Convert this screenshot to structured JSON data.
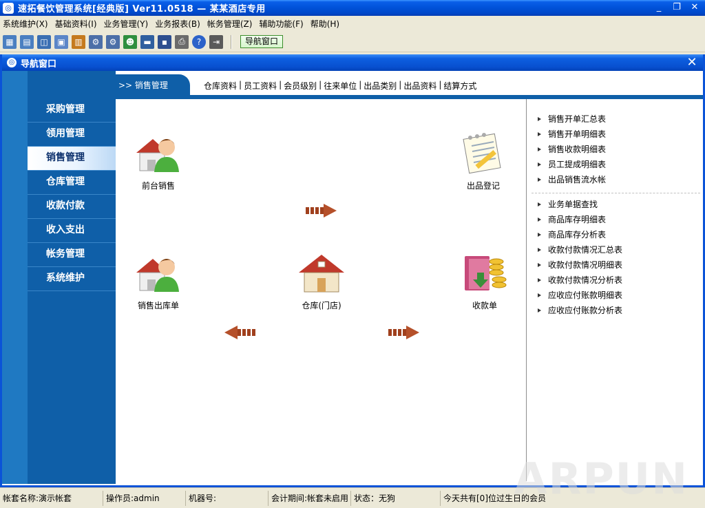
{
  "window": {
    "title": "速拓餐饮管理系统[经典版] Ver11.0518 — 某某酒店专用",
    "minimize": "_",
    "restore": "❐",
    "close": "✕"
  },
  "menu": [
    "系统维护(X)",
    "基础资料(I)",
    "业务管理(Y)",
    "业务报表(B)",
    "帐务管理(Z)",
    "辅助功能(F)",
    "帮助(H)"
  ],
  "toolbar": {
    "icons": [
      {
        "name": "grid-icon",
        "glyph": "▦",
        "color": "#4a7fc1"
      },
      {
        "name": "list-icon",
        "glyph": "▤",
        "color": "#4a7fc1"
      },
      {
        "name": "windows-icon",
        "glyph": "◫",
        "color": "#3a6fb3"
      },
      {
        "name": "form-icon",
        "glyph": "▣",
        "color": "#5b86c8"
      },
      {
        "name": "chart-icon",
        "glyph": "▥",
        "color": "#c57a1e"
      },
      {
        "name": "gear-icon",
        "glyph": "⚙",
        "color": "#4c6fa8"
      },
      {
        "name": "settings-icon",
        "glyph": "⚙",
        "color": "#4c6fa8"
      },
      {
        "name": "users-icon",
        "glyph": "☻",
        "color": "#2f8f3f"
      },
      {
        "name": "panel-icon",
        "glyph": "▬",
        "color": "#2f5f9f"
      },
      {
        "name": "save-icon",
        "glyph": "▪",
        "color": "#2e4f8f"
      },
      {
        "name": "print-icon",
        "glyph": "⎙",
        "color": "#6b6b6b"
      },
      {
        "name": "help-icon",
        "glyph": "?",
        "color": "#2c62c9"
      },
      {
        "name": "exit-icon",
        "glyph": "⇥",
        "color": "#5a5a5a"
      }
    ],
    "nav_window_label": "导航窗口"
  },
  "child_window": {
    "title": "导航窗口",
    "close": "✕"
  },
  "sidebar": {
    "items": [
      {
        "label": "采购管理",
        "active": false
      },
      {
        "label": "领用管理",
        "active": false
      },
      {
        "label": "销售管理",
        "active": true
      },
      {
        "label": "仓库管理",
        "active": false
      },
      {
        "label": "收款付款",
        "active": false
      },
      {
        "label": "收入支出",
        "active": false
      },
      {
        "label": "帐务管理",
        "active": false
      },
      {
        "label": "系统维护",
        "active": false
      }
    ]
  },
  "tabbar": {
    "active_label": ">> 销售管理",
    "links": [
      "仓库资料",
      "员工资料",
      "会员级别",
      "往来单位",
      "出品类别",
      "出品资料",
      "结算方式"
    ],
    "separator": "|"
  },
  "flow": {
    "front_sales": "前台销售",
    "product_register": "出品登记",
    "sales_outbound": "销售出库单",
    "warehouse": "仓库(门店)",
    "receipt": "收款单"
  },
  "reports": {
    "group1": [
      "销售开单汇总表",
      "销售开单明细表",
      "销售收款明细表",
      "员工提成明细表",
      "出品销售流水帐"
    ],
    "group2": [
      "业务单据查找",
      "商品库存明细表",
      "商品库存分析表",
      "收款付款情况汇总表",
      "收款付款情况明细表",
      "收款付款情况分析表",
      "应收应付账款明细表",
      "应收应付账款分析表"
    ]
  },
  "statusbar": {
    "account": "帐套名称:演示帐套",
    "operator": "操作员:admin",
    "machine": "机器号:",
    "period": "会计期间:帐套未启用",
    "status": "状态：无狗",
    "birthday": "今天共有[0]位过生日的会员",
    "watermark": "ARPUN"
  }
}
